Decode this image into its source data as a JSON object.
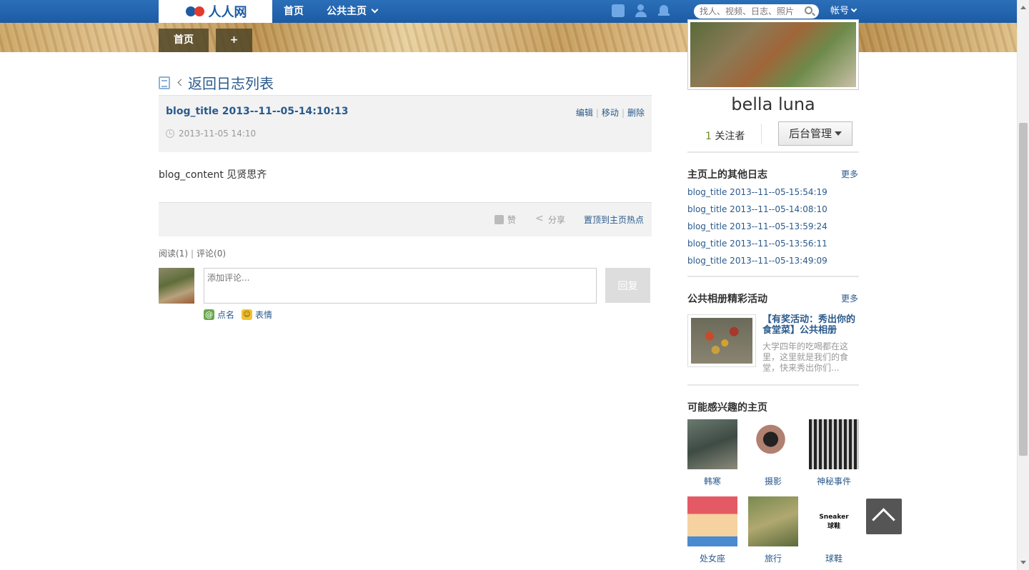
{
  "topbar": {
    "logo_text": "人人网",
    "nav_home": "首页",
    "nav_public": "公共主页",
    "search_placeholder": "找人、视频、日志、照片",
    "account": "帐号"
  },
  "banner_nav": {
    "home": "首页",
    "add": "+"
  },
  "back": {
    "label": "返回日志列表"
  },
  "post": {
    "title": "blog_title 2013--11--05-14:10:13",
    "actions": {
      "edit": "编辑",
      "move": "移动",
      "delete": "删除"
    },
    "date": "2013-11-05 14:10",
    "content": "blog_content 见贤思齐",
    "like": "赞",
    "share": "分享",
    "pin": "置顶到主页热点"
  },
  "counts": {
    "read": "阅读(1)",
    "comment": "评论(0)"
  },
  "comment_box": {
    "placeholder": "添加评论...",
    "reply": "回复",
    "mention": "点名",
    "emoji": "表情"
  },
  "profile": {
    "name": "bella luna",
    "follower_count": "1",
    "follower_label": "关注者",
    "admin_button": "后台管理"
  },
  "other_blogs": {
    "title": "主页上的其他日志",
    "more": "更多",
    "items": [
      "blog_title 2013--11--05-15:54:19",
      "blog_title 2013--11--05-14:08:10",
      "blog_title 2013--11--05-13:59:24",
      "blog_title 2013--11--05-13:56:11",
      "blog_title 2013--11--05-13:49:09"
    ]
  },
  "album": {
    "title": "公共相册精彩活动",
    "more": "更多",
    "item_title": "【有奖活动：秀出你的食堂菜】公共相册",
    "item_desc": "大学四年的吃喝都在这里，这里就是我们的食堂，快来秀出你们..."
  },
  "interests": {
    "title": "可能感兴趣的主页",
    "items": [
      {
        "label": "韩寒"
      },
      {
        "label": "摄影"
      },
      {
        "label": "神秘事件"
      },
      {
        "label": "处女座"
      },
      {
        "label": "旅行"
      },
      {
        "label": "球鞋"
      }
    ]
  },
  "sneaker_pic_text": [
    "Sneaker",
    "球鞋"
  ]
}
